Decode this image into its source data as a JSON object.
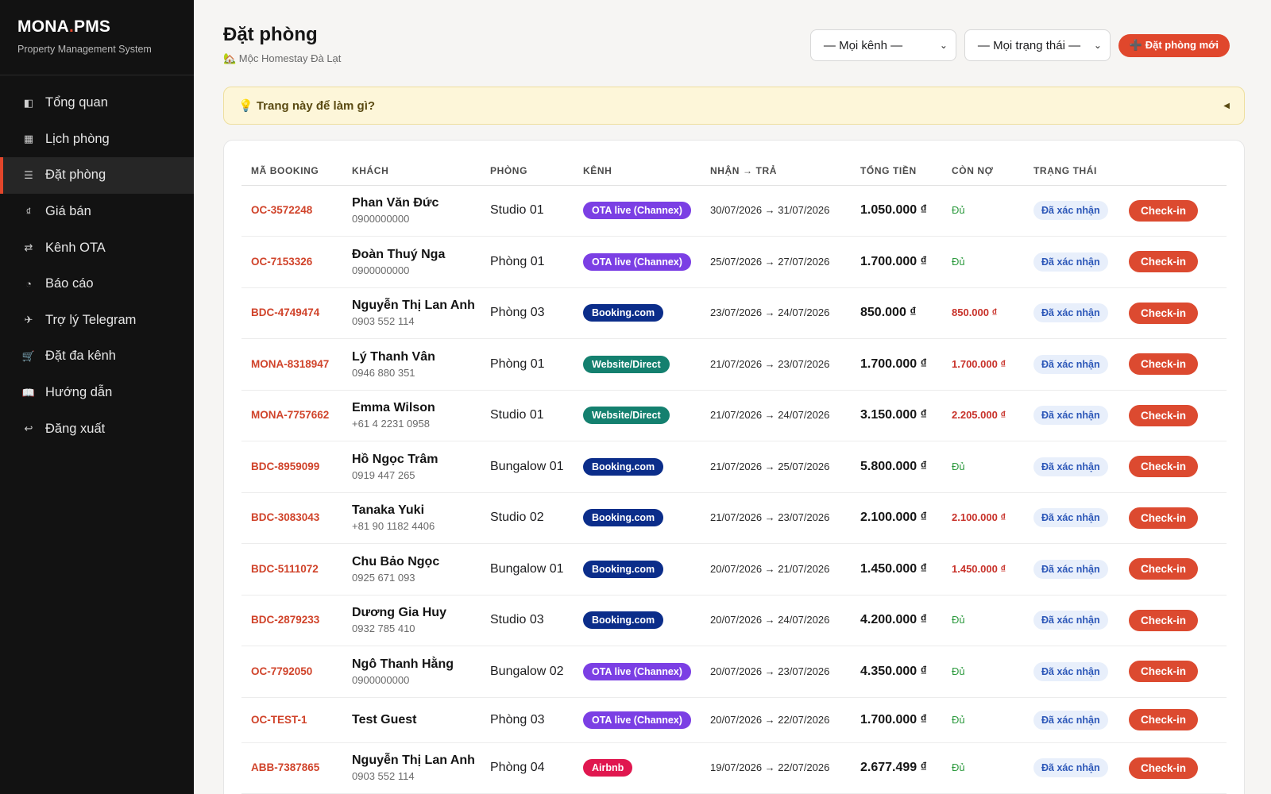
{
  "brand": {
    "name_main": "MONA",
    "name_dot": ".",
    "name_tail": "PMS",
    "subtitle": "Property Management System"
  },
  "nav": [
    {
      "icon": "◧",
      "label": "Tổng quan",
      "active": false
    },
    {
      "icon": "▦",
      "label": "Lịch phòng",
      "active": false
    },
    {
      "icon": "☰",
      "label": "Đặt phòng",
      "active": true
    },
    {
      "icon": "₫",
      "label": "Giá bán",
      "active": false
    },
    {
      "icon": "⇄",
      "label": "Kênh OTA",
      "active": false
    },
    {
      "icon": "◔",
      "label": "Báo cáo",
      "active": false
    },
    {
      "icon": "✈",
      "label": "Trợ lý Telegram",
      "active": false
    },
    {
      "icon": "🛒",
      "label": "Đặt đa kênh",
      "active": false
    },
    {
      "icon": "📖",
      "label": "Hướng dẫn",
      "active": false
    },
    {
      "icon": "↩",
      "label": "Đăng xuất",
      "active": false
    }
  ],
  "header": {
    "title": "Đặt phòng",
    "property": "🏡 Mộc Homestay Đà Lạt"
  },
  "filters": {
    "channel": "— Mọi kênh —",
    "status": "— Mọi trạng thái —",
    "new_button": "➕ Đặt phòng mới"
  },
  "hint": {
    "text": "💡 Trang này để làm gì?",
    "caret": "◀"
  },
  "table": {
    "columns": [
      "MÃ BOOKING",
      "KHÁCH",
      "PHÒNG",
      "KÊNH",
      "NHẬN → TRẢ",
      "TỔNG TIỀN",
      "CÒN NỢ",
      "TRẠNG THÁI",
      ""
    ],
    "checkin_label": "Check-in",
    "channel_colors": {
      "OTA live (Channex)": "#7b3fe4",
      "Booking.com": "#0b2d8a",
      "Website/Direct": "#14806f",
      "Airbnb": "#e0174f"
    },
    "rows": [
      {
        "code": "OC-3572248",
        "guest": "Phan Văn Đức",
        "phone": "0900000000",
        "room": "Studio 01",
        "channel": "OTA live (Channex)",
        "dates": "30/07/2026 → 31/07/2026",
        "total": "1.050.000 ₫",
        "owe": "Đủ",
        "owe_due": false,
        "status": "Đã xác nhận"
      },
      {
        "code": "OC-7153326",
        "guest": "Đoàn Thuý Nga",
        "phone": "0900000000",
        "room": "Phòng 01",
        "channel": "OTA live (Channex)",
        "dates": "25/07/2026 → 27/07/2026",
        "total": "1.700.000 ₫",
        "owe": "Đủ",
        "owe_due": false,
        "status": "Đã xác nhận"
      },
      {
        "code": "BDC-4749474",
        "guest": "Nguyễn Thị Lan Anh",
        "phone": "0903 552 114",
        "room": "Phòng 03",
        "channel": "Booking.com",
        "dates": "23/07/2026 → 24/07/2026",
        "total": "850.000 ₫",
        "owe": "850.000 ₫",
        "owe_due": true,
        "status": "Đã xác nhận"
      },
      {
        "code": "MONA-8318947",
        "guest": "Lý Thanh Vân",
        "phone": "0946 880 351",
        "room": "Phòng 01",
        "channel": "Website/Direct",
        "dates": "21/07/2026 → 23/07/2026",
        "total": "1.700.000 ₫",
        "owe": "1.700.000 ₫",
        "owe_due": true,
        "status": "Đã xác nhận"
      },
      {
        "code": "MONA-7757662",
        "guest": "Emma Wilson",
        "phone": "+61 4 2231 0958",
        "room": "Studio 01",
        "channel": "Website/Direct",
        "dates": "21/07/2026 → 24/07/2026",
        "total": "3.150.000 ₫",
        "owe": "2.205.000 ₫",
        "owe_due": true,
        "status": "Đã xác nhận"
      },
      {
        "code": "BDC-8959099",
        "guest": "Hồ Ngọc Trâm",
        "phone": "0919 447 265",
        "room": "Bungalow 01",
        "channel": "Booking.com",
        "dates": "21/07/2026 → 25/07/2026",
        "total": "5.800.000 ₫",
        "owe": "Đủ",
        "owe_due": false,
        "status": "Đã xác nhận"
      },
      {
        "code": "BDC-3083043",
        "guest": "Tanaka Yuki",
        "phone": "+81 90 1182 4406",
        "room": "Studio 02",
        "channel": "Booking.com",
        "dates": "21/07/2026 → 23/07/2026",
        "total": "2.100.000 ₫",
        "owe": "2.100.000 ₫",
        "owe_due": true,
        "status": "Đã xác nhận"
      },
      {
        "code": "BDC-5111072",
        "guest": "Chu Bảo Ngọc",
        "phone": "0925 671 093",
        "room": "Bungalow 01",
        "channel": "Booking.com",
        "dates": "20/07/2026 → 21/07/2026",
        "total": "1.450.000 ₫",
        "owe": "1.450.000 ₫",
        "owe_due": true,
        "status": "Đã xác nhận"
      },
      {
        "code": "BDC-2879233",
        "guest": "Dương Gia Huy",
        "phone": "0932 785 410",
        "room": "Studio 03",
        "channel": "Booking.com",
        "dates": "20/07/2026 → 24/07/2026",
        "total": "4.200.000 ₫",
        "owe": "Đủ",
        "owe_due": false,
        "status": "Đã xác nhận"
      },
      {
        "code": "OC-7792050",
        "guest": "Ngô Thanh Hằng",
        "phone": "0900000000",
        "room": "Bungalow 02",
        "channel": "OTA live (Channex)",
        "dates": "20/07/2026 → 23/07/2026",
        "total": "4.350.000 ₫",
        "owe": "Đủ",
        "owe_due": false,
        "status": "Đã xác nhận"
      },
      {
        "code": "OC-TEST-1",
        "guest": "Test Guest",
        "phone": "",
        "room": "Phòng 03",
        "channel": "OTA live (Channex)",
        "dates": "20/07/2026 → 22/07/2026",
        "total": "1.700.000 ₫",
        "owe": "Đủ",
        "owe_due": false,
        "status": "Đã xác nhận"
      },
      {
        "code": "ABB-7387865",
        "guest": "Nguyễn Thị Lan Anh",
        "phone": "0903 552 114",
        "room": "Phòng 04",
        "channel": "Airbnb",
        "dates": "19/07/2026 → 22/07/2026",
        "total": "2.677.499 ₫",
        "owe": "Đủ",
        "owe_due": false,
        "status": "Đã xác nhận"
      }
    ]
  },
  "colors": {
    "accent": "#e2462b",
    "sidebar_bg": "#121212",
    "hint_bg": "#fdf6d9"
  }
}
